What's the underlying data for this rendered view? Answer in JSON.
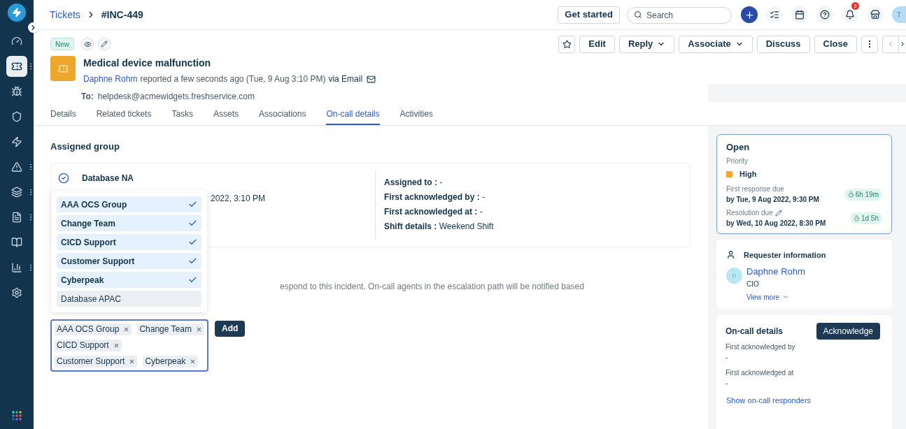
{
  "sidebar": {
    "items": [
      {
        "selected": false,
        "menu": false
      },
      {
        "selected": true,
        "menu": true
      },
      {
        "selected": false,
        "menu": false
      },
      {
        "selected": false,
        "menu": false
      },
      {
        "selected": false,
        "menu": false
      },
      {
        "selected": false,
        "menu": true
      },
      {
        "selected": false,
        "menu": true
      },
      {
        "selected": false,
        "menu": true
      },
      {
        "selected": false,
        "menu": false
      },
      {
        "selected": false,
        "menu": true
      },
      {
        "selected": false,
        "menu": false
      }
    ]
  },
  "breadcrumb": {
    "parent": "Tickets",
    "current": "#INC-449"
  },
  "topbar": {
    "get_started": "Get started",
    "search": {
      "placeholder": "Search"
    },
    "notifications": "3",
    "avatar": "T"
  },
  "ticket": {
    "status": "New",
    "actions": [
      {
        "label": "Edit",
        "dropdown": false
      },
      {
        "label": "Reply",
        "dropdown": true
      },
      {
        "label": "Associate",
        "dropdown": true
      },
      {
        "label": "Discuss",
        "dropdown": false
      },
      {
        "label": "Close",
        "dropdown": false
      }
    ],
    "title": "Medical device malfunction",
    "requester": "Daphne Rohm",
    "reported": "reported a few seconds ago (Tue, 9 Aug 3:10 PM)",
    "channel": "via Email",
    "to_label": "To:",
    "to": "helpdesk@acmewidgets.freshservice.com"
  },
  "tabs": [
    {
      "label": "Details",
      "selected": false
    },
    {
      "label": "Related tickets",
      "selected": false
    },
    {
      "label": "Tasks",
      "selected": false
    },
    {
      "label": "Assets",
      "selected": false
    },
    {
      "label": "Associations",
      "selected": false
    },
    {
      "label": "On-call details",
      "selected": true
    },
    {
      "label": "Activities",
      "selected": false
    }
  ],
  "assigned_group": {
    "heading": "Assigned group",
    "group": "Database NA",
    "created": "2022, 3:10 PM",
    "fields": [
      "**Assigned to :** -",
      "**First acknowledged by :** -",
      "**First acknowledged at :** -",
      "**Shift details :** Weekend Shift"
    ]
  },
  "note": "espond to this incident. On-call agents in the escalation path will be notified based",
  "dropdown": [
    {
      "label": "AAA OCS Group",
      "selected": true
    },
    {
      "label": "Change Team",
      "selected": true
    },
    {
      "label": "CICD Support",
      "selected": true
    },
    {
      "label": "Customer Support",
      "selected": true
    },
    {
      "label": "Cyberpeak",
      "selected": true
    },
    {
      "label": "Database APAC",
      "selected": false
    }
  ],
  "tags": [
    "AAA OCS Group",
    "Change Team",
    "CICD Support",
    "Customer Support",
    "Cyberpeak"
  ],
  "add": "Add",
  "status_card": {
    "status": "Open",
    "priority_label": "Priority",
    "priority": "High",
    "dues": [
      {
        "label": "First response due",
        "editable": false,
        "date": "by Tue, 9 Aug 2022, 9:30 PM",
        "timer": "6h 19m"
      },
      {
        "label": "Resolution due",
        "editable": true,
        "date": "by Wed, 10 Aug 2022, 8:30 PM",
        "timer": "1d 5h"
      }
    ]
  },
  "requester": {
    "heading": "Requester information",
    "initial": "D",
    "name": "Daphne Rohm",
    "role": "CIO",
    "more": "View more"
  },
  "oncall": {
    "heading": "On-call details",
    "button": "Acknowledge",
    "fields": [
      {
        "label": "First acknowledged by",
        "value": "-"
      },
      {
        "label": "First acknowledged at",
        "value": "-"
      }
    ],
    "link": "Show on-call responders"
  }
}
